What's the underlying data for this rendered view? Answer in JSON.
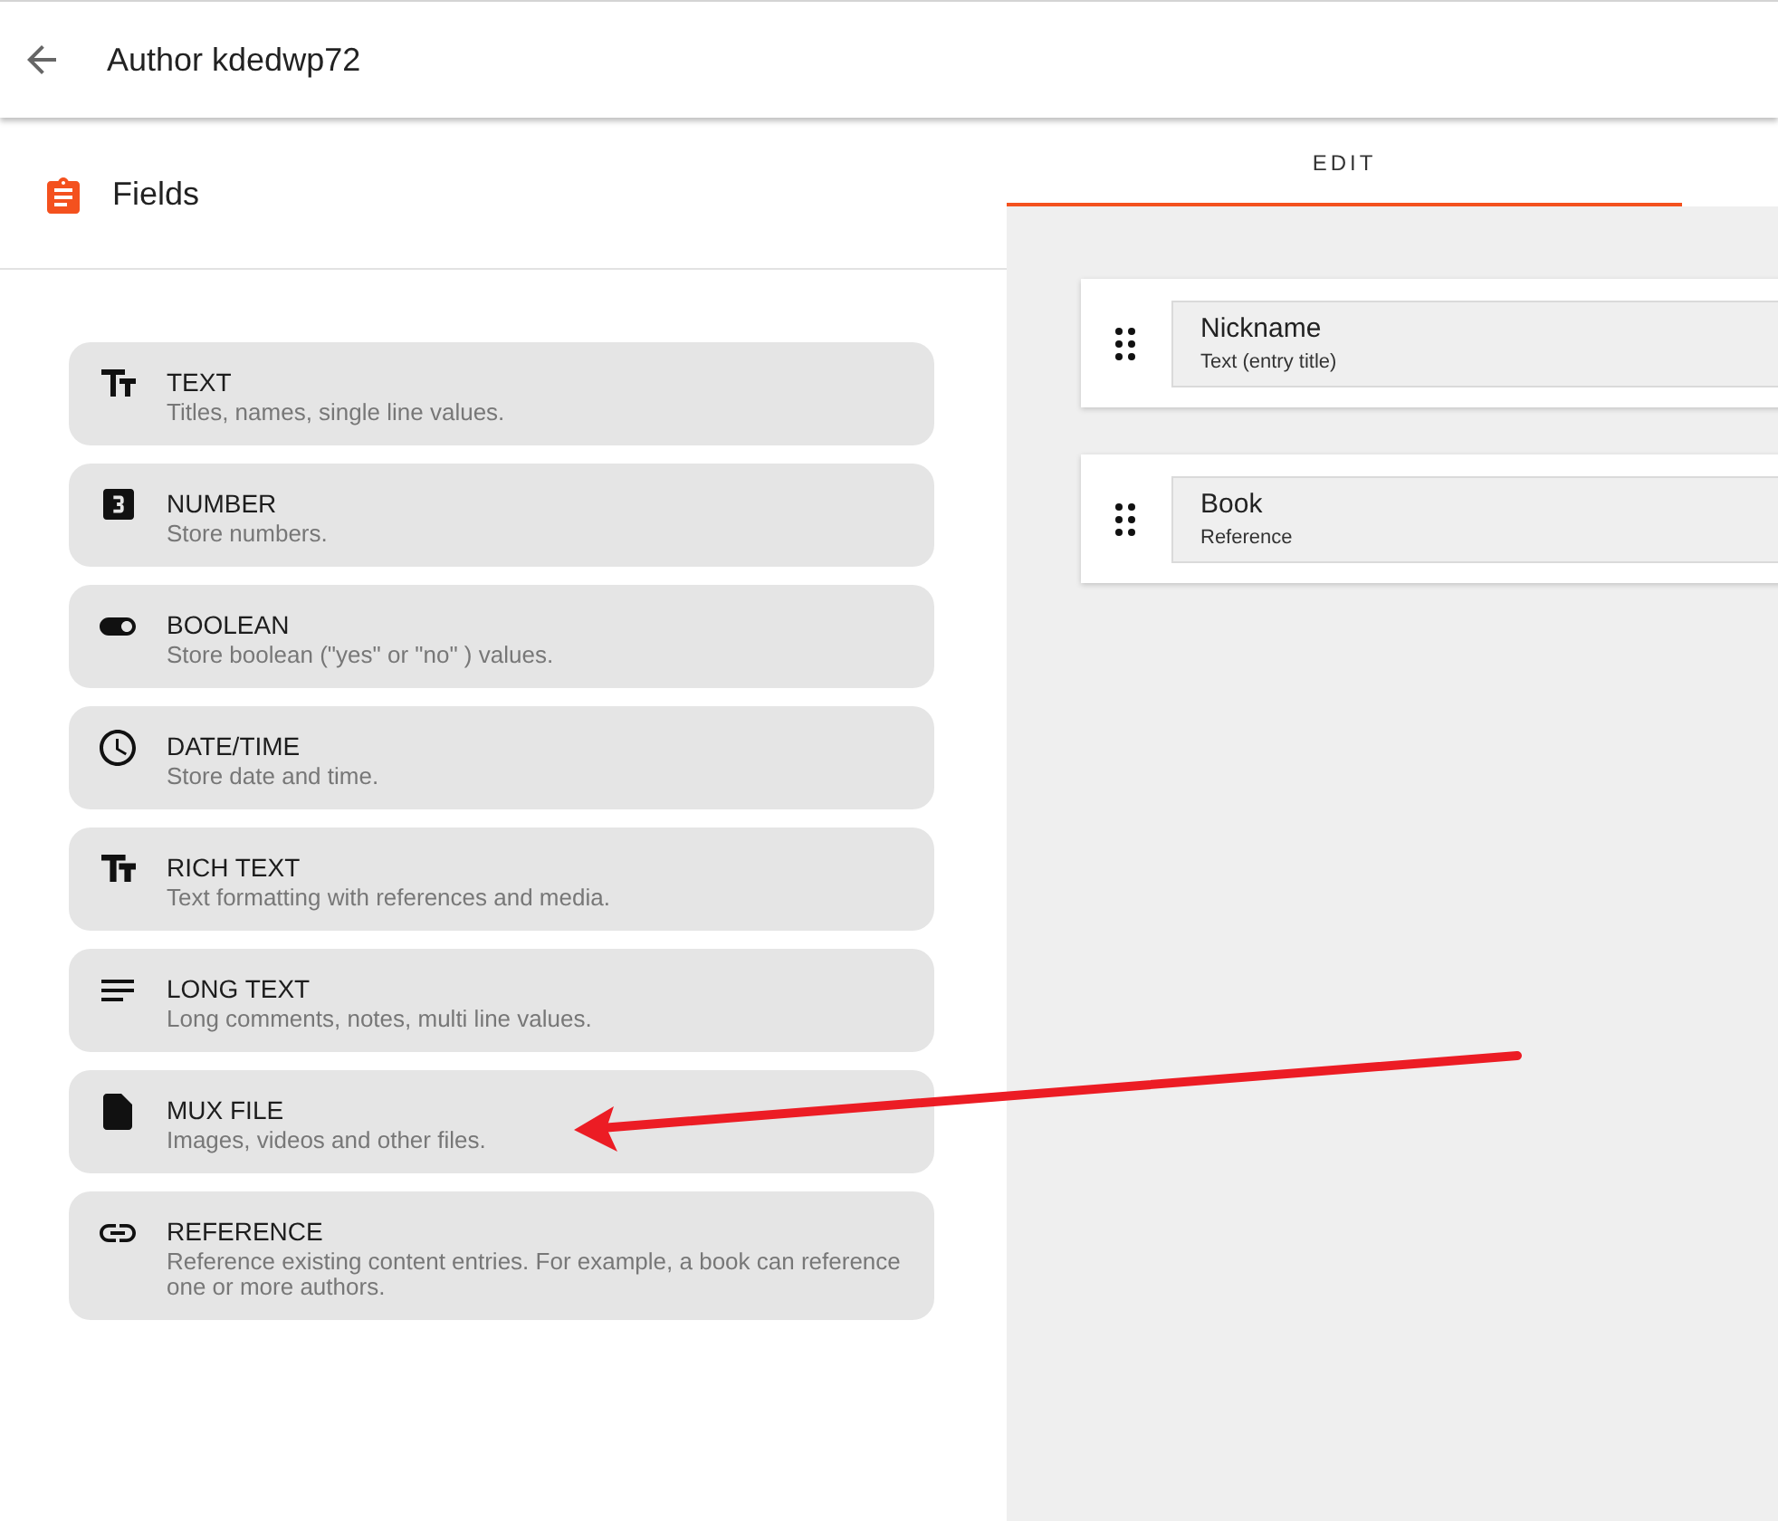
{
  "header": {
    "title": "Author kdedwp72"
  },
  "sidebar": {
    "title": "Fields",
    "field_types": [
      {
        "kind": "text",
        "name": "TEXT",
        "description": "Titles, names, single line values."
      },
      {
        "kind": "number",
        "name": "NUMBER",
        "description": "Store numbers."
      },
      {
        "kind": "boolean",
        "name": "BOOLEAN",
        "description": "Store boolean (\"yes\" or \"no\" ) values."
      },
      {
        "kind": "datetime",
        "name": "DATE/TIME",
        "description": "Store date and time."
      },
      {
        "kind": "richtext",
        "name": "RICH TEXT",
        "description": "Text formatting with references and media."
      },
      {
        "kind": "longtext",
        "name": "LONG TEXT",
        "description": "Long comments, notes, multi line values."
      },
      {
        "kind": "file",
        "name": "MUX FILE",
        "description": "Images, videos and other files."
      },
      {
        "kind": "reference",
        "name": "REFERENCE",
        "description": "Reference existing content entries. For example, a book can reference one or more authors."
      }
    ]
  },
  "tabs": [
    {
      "label": "EDIT",
      "selected": true
    }
  ],
  "fields": [
    {
      "name": "Nickname",
      "type": "Text (entry title)"
    },
    {
      "name": "Book",
      "type": "Reference"
    }
  ]
}
